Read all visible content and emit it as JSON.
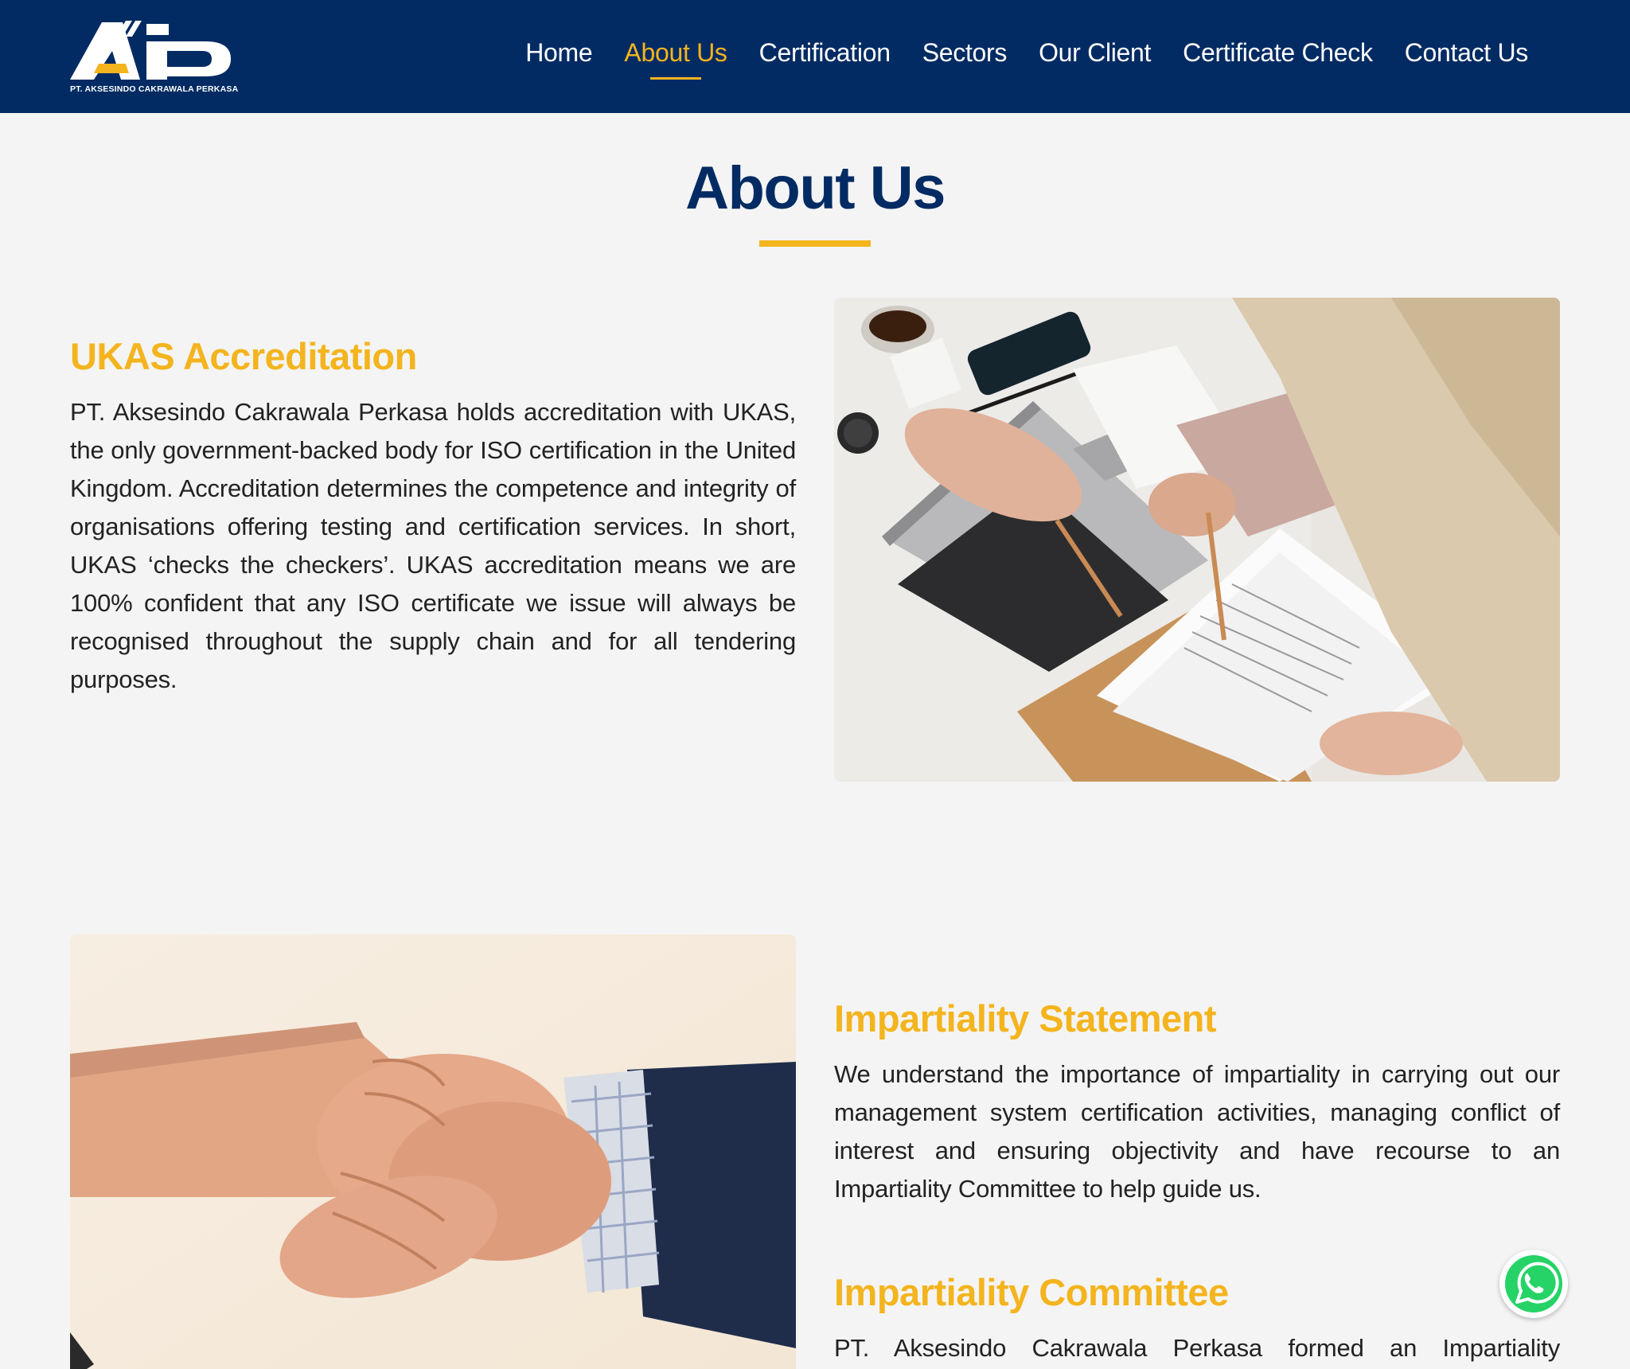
{
  "brand": {
    "logo_letters": "AP",
    "company_caption": "PT. AKSESINDO CAKRAWALA PERKASA"
  },
  "nav": {
    "items": [
      {
        "label": "Home",
        "active": false
      },
      {
        "label": "About Us",
        "active": true
      },
      {
        "label": "Certification",
        "active": false
      },
      {
        "label": "Sectors",
        "active": false
      },
      {
        "label": "Our Client",
        "active": false
      },
      {
        "label": "Certificate Check",
        "active": false
      },
      {
        "label": "Contact Us",
        "active": false
      }
    ]
  },
  "page": {
    "title": "About Us"
  },
  "sections": {
    "ukas": {
      "heading": "UKAS Accreditation",
      "body": "PT. Aksesindo Cakrawala Perkasa holds accreditation with UKAS, the only government-backed body for ISO certification in the United Kingdom. Accreditation determines the competence and integrity of organisations offering testing and certification services. In short, UKAS ‘checks the checkers’. UKAS accreditation means we are 100% confident that any ISO certificate we issue will always be recognised throughout the supply chain and for all tendering purposes.",
      "image_subject": "business-meeting-laptop-documents-photo"
    },
    "impartiality_statement": {
      "heading": "Impartiality Statement",
      "body": "We understand the importance of impartiality in carrying out our management system certification activities, managing conflict of interest and ensuring objectivity and have recourse to an Impartiality Committee to help guide us."
    },
    "impartiality_committee": {
      "heading": "Impartiality Committee",
      "body": "PT. Aksesindo Cakrawala Perkasa formed an Impartiality"
    },
    "handshake": {
      "image_subject": "handshake-photo"
    }
  },
  "colors": {
    "navy": "#032b63",
    "accent": "#f4b41e",
    "background": "#f4f4f4",
    "text": "#222222",
    "whatsapp_green": "#25d366"
  },
  "widgets": {
    "whatsapp_icon": "whatsapp-icon"
  }
}
